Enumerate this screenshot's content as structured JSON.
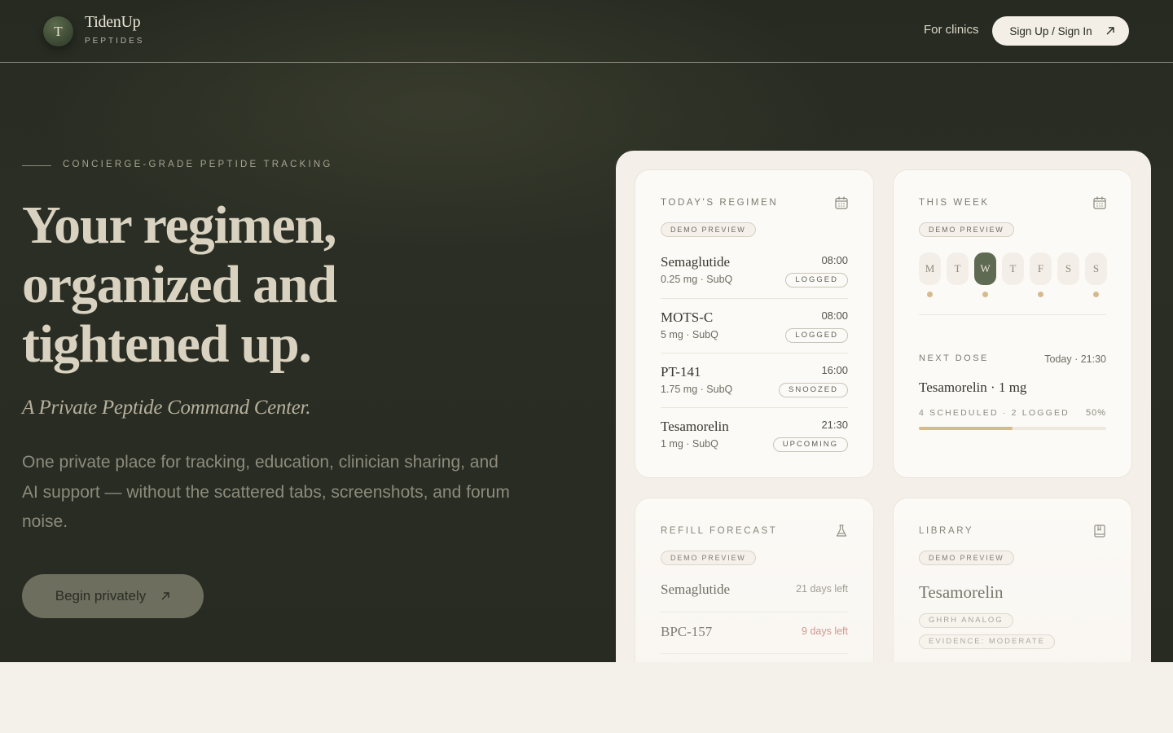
{
  "brand": {
    "initial": "T",
    "name": "TidenUp",
    "sub": "PEPTIDES"
  },
  "nav": {
    "clinics_label": "For clinics",
    "cta_label": "Sign Up / Sign In"
  },
  "hero": {
    "eyebrow": "CONCIERGE-GRADE PEPTIDE TRACKING",
    "headline": [
      "Your regimen,",
      "organized and",
      "tightened up."
    ],
    "tagline": "A Private Peptide Command Center.",
    "lede": "One private place for tracking, education, clinician sharing, and AI support — without the scattered tabs, screenshots, and forum noise.",
    "cta_label": "Begin privately"
  },
  "regimen": {
    "title": "TODAY'S REGIMEN",
    "chip": "DEMO PREVIEW",
    "icon": "calendar-icon",
    "items": [
      {
        "name": "Semaglutide",
        "dose": "0.25 mg · SubQ",
        "time": "08:00",
        "status": "LOGGED"
      },
      {
        "name": "MOTS-C",
        "dose": "5 mg · SubQ",
        "time": "08:00",
        "status": "LOGGED"
      },
      {
        "name": "PT-141",
        "dose": "1.75 mg · SubQ",
        "time": "16:00",
        "status": "SNOOZED"
      },
      {
        "name": "Tesamorelin",
        "dose": "1 mg · SubQ",
        "time": "21:30",
        "status": "UPCOMING"
      }
    ]
  },
  "week": {
    "title": "THIS WEEK",
    "chip": "DEMO PREVIEW",
    "icon": "calendar-icon",
    "days": [
      {
        "label": "M",
        "active": false,
        "dose": true
      },
      {
        "label": "T",
        "active": false,
        "dose": false
      },
      {
        "label": "W",
        "active": true,
        "dose": true
      },
      {
        "label": "T",
        "active": false,
        "dose": false
      },
      {
        "label": "F",
        "active": false,
        "dose": true
      },
      {
        "label": "S",
        "active": false,
        "dose": false
      },
      {
        "label": "S",
        "active": false,
        "dose": true
      }
    ],
    "next_label": "NEXT DOSE",
    "next_time": "Today · 21:30",
    "next_name": "Tesamorelin · 1 mg",
    "stats": "4 SCHEDULED · 2 LOGGED",
    "progress_label": "50%",
    "progress": 0.5
  },
  "refill": {
    "title": "REFILL FORECAST",
    "chip": "DEMO PREVIEW",
    "icon": "flask-icon",
    "items": [
      {
        "name": "Semaglutide",
        "left": "21 days left",
        "warn": false
      },
      {
        "name": "BPC-157",
        "left": "9 days left",
        "warn": true
      }
    ]
  },
  "library": {
    "title": "LIBRARY",
    "chip": "DEMO PREVIEW",
    "icon": "book-icon",
    "name": "Tesamorelin",
    "tags": [
      "GHRH ANALOG",
      "EVIDENCE: MODERATE"
    ]
  },
  "colors": {
    "accent": "#5f6a52",
    "gold": "#d8b98c",
    "warn": "#c0756b",
    "dark": "#262a21",
    "cream": "#f4f0e9"
  }
}
